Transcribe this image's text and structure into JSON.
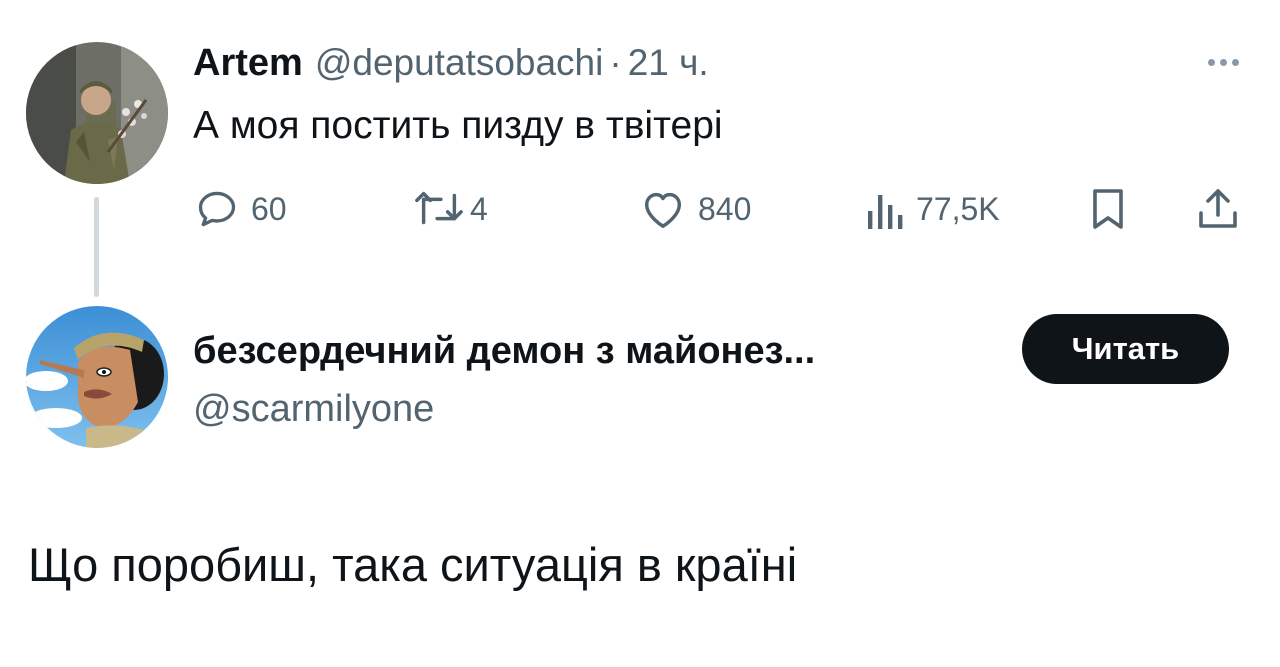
{
  "tweet": {
    "author_name": "Artem",
    "handle": "@deputatsobachi",
    "separator": "·",
    "time": "21 ч.",
    "text": "А моя постить пизду в твітері",
    "more_icon": "more-horizontal-icon",
    "actions": {
      "replies": "60",
      "retweets": "4",
      "likes": "840",
      "views": "77,5K"
    }
  },
  "reply_card": {
    "display_name": "безсердечний демон з майонез...",
    "handle": "@scarmilyone",
    "follow_label": "Читать",
    "text": "Що поробиш, така ситуація в країні"
  },
  "colors": {
    "text": "#0f1419",
    "muted": "#536471",
    "button_bg": "#0f1419",
    "thread_line": "#cfd9de"
  }
}
